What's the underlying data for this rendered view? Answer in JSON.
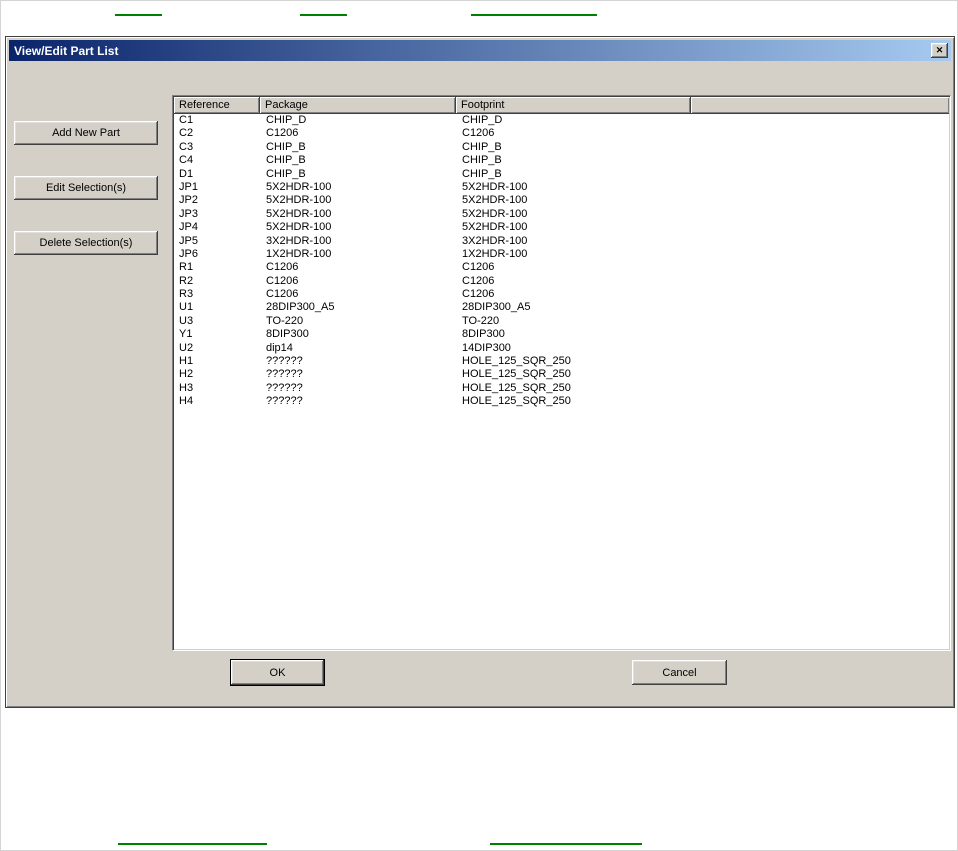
{
  "page": {
    "decor": {
      "underline_color": "#008000"
    }
  },
  "dialog": {
    "title": "View/Edit Part List",
    "colors": {
      "titlebar_gradient_start": "#0a246a",
      "titlebar_gradient_end": "#a6caf0",
      "face": "#d4d0c8",
      "list_background": "#ffffff"
    },
    "icons": {
      "close": "✕"
    },
    "buttons": {
      "add": "Add New Part",
      "edit": "Edit Selection(s)",
      "delete": "Delete Selection(s)",
      "ok": "OK",
      "cancel": "Cancel"
    },
    "list": {
      "columns": [
        "Reference",
        "Package",
        "Footprint"
      ],
      "rows": [
        [
          "C1",
          "CHIP_D",
          "CHIP_D"
        ],
        [
          "C2",
          "C1206",
          "C1206"
        ],
        [
          "C3",
          "CHIP_B",
          "CHIP_B"
        ],
        [
          "C4",
          "CHIP_B",
          "CHIP_B"
        ],
        [
          "D1",
          "CHIP_B",
          "CHIP_B"
        ],
        [
          "JP1",
          "5X2HDR-100",
          "5X2HDR-100"
        ],
        [
          "JP2",
          "5X2HDR-100",
          "5X2HDR-100"
        ],
        [
          "JP3",
          "5X2HDR-100",
          "5X2HDR-100"
        ],
        [
          "JP4",
          "5X2HDR-100",
          "5X2HDR-100"
        ],
        [
          "JP5",
          "3X2HDR-100",
          "3X2HDR-100"
        ],
        [
          "JP6",
          "1X2HDR-100",
          "1X2HDR-100"
        ],
        [
          "R1",
          "C1206",
          "C1206"
        ],
        [
          "R2",
          "C1206",
          "C1206"
        ],
        [
          "R3",
          "C1206",
          "C1206"
        ],
        [
          "U1",
          "28DIP300_A5",
          "28DIP300_A5"
        ],
        [
          "U3",
          "TO-220",
          "TO-220"
        ],
        [
          "Y1",
          "8DIP300",
          "8DIP300"
        ],
        [
          "U2",
          "dip14",
          "14DIP300"
        ],
        [
          "H1",
          "??????",
          "HOLE_125_SQR_250"
        ],
        [
          "H2",
          "??????",
          "HOLE_125_SQR_250"
        ],
        [
          "H3",
          "??????",
          "HOLE_125_SQR_250"
        ],
        [
          "H4",
          "??????",
          "HOLE_125_SQR_250"
        ]
      ]
    }
  }
}
